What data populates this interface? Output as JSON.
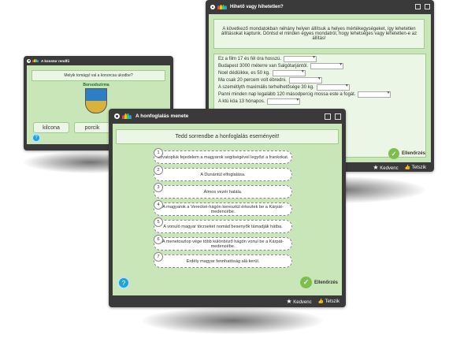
{
  "windows": {
    "matching": {
      "title": "A konstor rendfű"
    },
    "truefalse": {
      "title": "Hihető vagy hihetetlen?",
      "instruction": "A következő mondatokban néhány helyen állítsuk a helyes mértékegységeket, így lehetetlen állításokat kaptunk. Döntsd el minden egyes mondatról, hogy lehetséges vagy lehetetlen-e az állítás!",
      "rows": [
        "Ez a film 17 és fél óra hosszú.",
        "Budapest 3000 méterre van Salgótarjántól.",
        "Noel dédüikke, es 50 kg.",
        "Ma csak 20 percem volt ébredni.",
        "A szemétlyth maximális terhelhetősége 30 kg.",
        "Panni minden nap legalább 120 másodpercig mossa este a fogát.",
        "A ktú köa 13 hónapos."
      ],
      "check_label": "Ellenőrzés",
      "favorite_label": "Kedvenc",
      "like_label": "Tetszik"
    },
    "quiz": {
      "title": "A konstor rendfű",
      "question": "Melyik tomágyl val a konorcsa ukodbe?",
      "crest_text": "Borsodszirma",
      "options": [
        "kilcona",
        "porcik",
        ""
      ]
    },
    "ordering": {
      "title": "A honfoglalás menete",
      "instruction": "Tedd sorrendbe a honfoglalás eseményeit!",
      "items": [
        {
          "n": "1",
          "text": "Szvatopluk fejedelem a magyarok segítségével legyőzi a frankokat."
        },
        {
          "n": "2",
          "text": "A Dunántúl elfoglalása."
        },
        {
          "n": "3",
          "text": "Álmos vezér halála."
        },
        {
          "n": "4",
          "text": "A magyarok a Vereckei-hágón keresztül érkeztek be a Kárpát-medencébe."
        },
        {
          "n": "5",
          "text": "A vonuló magyar törzseket nomád besenyők támadják hátba."
        },
        {
          "n": "6",
          "text": "A menetoszlop vége több különböző hágón vonul be a Kárpát-medencébe."
        },
        {
          "n": "7",
          "text": "Erdély magyar fennhatóság alá kerül."
        }
      ],
      "check_label": "Ellenőrzés",
      "favorite_label": "Kedvenc",
      "like_label": "Tetszik"
    }
  },
  "colors": {
    "window_bg": "#3a3a3a",
    "content_bg": "#c8e6b8",
    "check_green": "#7dbf4d",
    "help_blue": "#1ea3d6"
  },
  "icons": {
    "logo": "rainbow-logo-icon",
    "help": "question-circle-icon",
    "check": "checkmark-icon",
    "star": "star-icon",
    "like": "thumbs-up-icon"
  }
}
